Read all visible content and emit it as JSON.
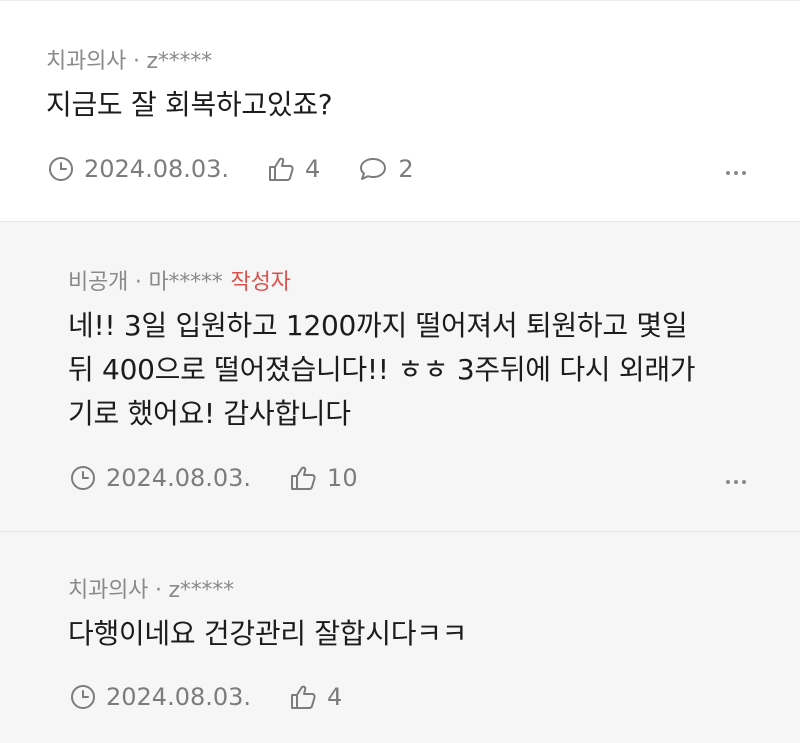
{
  "comments": [
    {
      "author": "치과의사 · z*****",
      "badge": "",
      "lines": [
        "지금도 잘 회복하고있죠?"
      ],
      "date": "2024.08.03.",
      "likes": "4",
      "replies": "2"
    },
    {
      "author": "비공개 · 마*****",
      "badge": "작성자",
      "lines": [
        "네!! 3일 입원하고 1200까지 떨어져서 퇴원하고 몇일",
        "뒤 400으로 떨어졌습니다!! ㅎㅎ 3주뒤에 다시 외래가",
        "기로 했어요! 감사합니다"
      ],
      "date": "2024.08.03.",
      "likes": "10",
      "replies": ""
    },
    {
      "author": "치과의사 · z*****",
      "badge": "",
      "lines": [
        "다행이네요 건강관리 잘합시다ㅋㅋ"
      ],
      "date": "2024.08.03.",
      "likes": "4",
      "replies": ""
    }
  ],
  "icons": {
    "clock": "clock-icon",
    "like": "thumbs-up-icon",
    "reply": "speech-bubble-icon",
    "more": "more-dots-icon"
  },
  "colors": {
    "author_badge": "#d9534f",
    "reply_background": "#f6f6f6"
  }
}
